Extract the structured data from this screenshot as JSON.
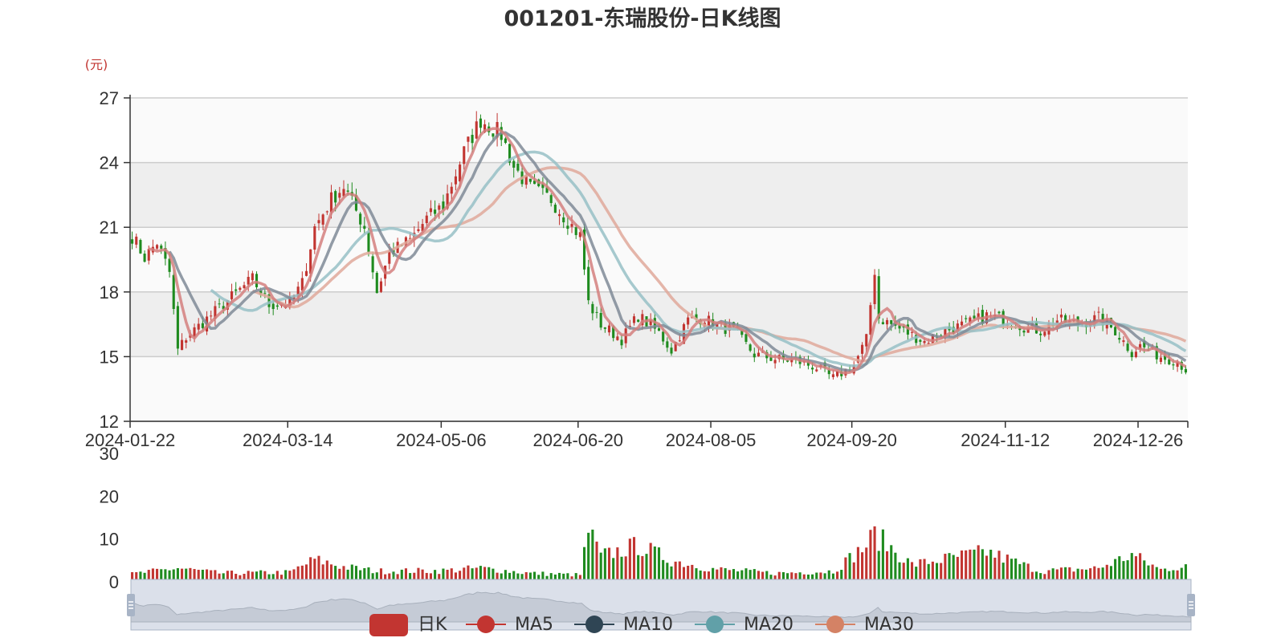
{
  "title": "001201-东瑞股份-日K线图",
  "unit_label": "(元)",
  "colors": {
    "up": "#c23531",
    "down": "#1f8b1f",
    "ma5": "#d47f7e",
    "ma10": "#7f8a96",
    "ma20": "#96bfc6",
    "ma30": "#dfa89a",
    "legend_k": "#c23531",
    "legend_ma5": "#c23531",
    "legend_ma10": "#2f4554",
    "legend_ma20": "#61a0a8",
    "legend_ma30": "#d48265"
  },
  "legend": [
    "日K",
    "MA5",
    "MA10",
    "MA20",
    "MA30"
  ],
  "chart_data": [
    {
      "type": "candlestick",
      "title": "001201-东瑞股份-日K线图",
      "ylabel": "(元)",
      "x_ticks": [
        "2024-01-22",
        "2024-03-14",
        "2024-05-06",
        "2024-06-20",
        "2024-08-05",
        "2024-09-20",
        "2024-11-12",
        "2024-12-26"
      ],
      "y_ticks": [
        "12",
        "15",
        "18",
        "21",
        "24",
        "27"
      ],
      "ylim": [
        12,
        27
      ],
      "grid": true,
      "close_anchors": [
        [
          "2024-01-22",
          20.6
        ],
        [
          "2024-01-25",
          19.6
        ],
        [
          "2024-01-30",
          20.3
        ],
        [
          "2024-02-02",
          18.9
        ],
        [
          "2024-02-06",
          15.3
        ],
        [
          "2024-02-08",
          15.9
        ],
        [
          "2024-02-22",
          17.6
        ],
        [
          "2024-03-01",
          18.6
        ],
        [
          "2024-03-07",
          17.4
        ],
        [
          "2024-03-14",
          17.5
        ],
        [
          "2024-03-19",
          18.4
        ],
        [
          "2024-03-22",
          21.0
        ],
        [
          "2024-03-28",
          22.3
        ],
        [
          "2024-04-02",
          22.9
        ],
        [
          "2024-04-09",
          21.0
        ],
        [
          "2024-04-12",
          18.0
        ],
        [
          "2024-04-17",
          19.8
        ],
        [
          "2024-04-24",
          20.4
        ],
        [
          "2024-04-30",
          21.4
        ],
        [
          "2024-05-06",
          22.0
        ],
        [
          "2024-05-13",
          24.5
        ],
        [
          "2024-05-17",
          26.0
        ],
        [
          "2024-05-24",
          25.3
        ],
        [
          "2024-05-29",
          23.8
        ],
        [
          "2024-06-04",
          22.8
        ],
        [
          "2024-06-11",
          22.3
        ],
        [
          "2024-06-17",
          21.3
        ],
        [
          "2024-06-20",
          20.6
        ],
        [
          "2024-06-24",
          17.5
        ],
        [
          "2024-06-27",
          16.5
        ],
        [
          "2024-07-04",
          15.8
        ],
        [
          "2024-07-10",
          16.9
        ],
        [
          "2024-07-17",
          16.1
        ],
        [
          "2024-07-22",
          15.3
        ],
        [
          "2024-07-26",
          16.7
        ],
        [
          "2024-08-01",
          16.8
        ],
        [
          "2024-08-05",
          16.5
        ],
        [
          "2024-08-12",
          16.2
        ],
        [
          "2024-08-19",
          15.1
        ],
        [
          "2024-08-26",
          14.9
        ],
        [
          "2024-09-02",
          14.8
        ],
        [
          "2024-09-09",
          14.5
        ],
        [
          "2024-09-13",
          14.0
        ],
        [
          "2024-09-20",
          14.6
        ],
        [
          "2024-09-25",
          15.8
        ],
        [
          "2024-09-27",
          19.0
        ],
        [
          "2024-09-30",
          16.8
        ],
        [
          "2024-10-10",
          16.0
        ],
        [
          "2024-10-15",
          15.7
        ],
        [
          "2024-10-22",
          16.2
        ],
        [
          "2024-10-29",
          16.5
        ],
        [
          "2024-11-05",
          16.9
        ],
        [
          "2024-11-12",
          16.7
        ],
        [
          "2024-11-18",
          16.4
        ],
        [
          "2024-11-22",
          16.2
        ],
        [
          "2024-11-28",
          16.7
        ],
        [
          "2024-12-05",
          16.5
        ],
        [
          "2024-12-12",
          16.8
        ],
        [
          "2024-12-18",
          16.2
        ],
        [
          "2024-12-24",
          15.2
        ],
        [
          "2024-12-26",
          15.5
        ],
        [
          "2025-01-02",
          15.0
        ],
        [
          "2025-01-08",
          14.8
        ],
        [
          "2025-01-10",
          14.4
        ]
      ],
      "series": [
        {
          "name": "日K",
          "kind": "candlestick"
        },
        {
          "name": "MA5",
          "kind": "line",
          "window": 5
        },
        {
          "name": "MA10",
          "kind": "line",
          "window": 10
        },
        {
          "name": "MA20",
          "kind": "line",
          "window": 20
        },
        {
          "name": "MA30",
          "kind": "line",
          "window": 30
        }
      ]
    },
    {
      "type": "bar",
      "y_ticks": [
        "0",
        "10",
        "20",
        "30"
      ],
      "ylim": [
        0,
        30
      ],
      "volume_anchors": [
        [
          "2024-01-22",
          1.8
        ],
        [
          "2024-02-06",
          3.2
        ],
        [
          "2024-02-20",
          2.0
        ],
        [
          "2024-03-14",
          2.2
        ],
        [
          "2024-03-22",
          5.2
        ],
        [
          "2024-04-02",
          3.5
        ],
        [
          "2024-04-12",
          2.5
        ],
        [
          "2024-05-06",
          2.6
        ],
        [
          "2024-05-17",
          3.2
        ],
        [
          "2024-06-04",
          2.0
        ],
        [
          "2024-06-20",
          1.6
        ],
        [
          "2024-06-24",
          12.0
        ],
        [
          "2024-06-27",
          6.0
        ],
        [
          "2024-07-10",
          8.5
        ],
        [
          "2024-07-22",
          5.0
        ],
        [
          "2024-08-05",
          3.0
        ],
        [
          "2024-08-26",
          2.0
        ],
        [
          "2024-09-13",
          2.5
        ],
        [
          "2024-09-25",
          8.5
        ],
        [
          "2024-09-27",
          11.0
        ],
        [
          "2024-10-10",
          4.0
        ],
        [
          "2024-11-05",
          7.0
        ],
        [
          "2024-11-22",
          2.5
        ],
        [
          "2024-12-12",
          3.2
        ],
        [
          "2024-12-24",
          6.3
        ],
        [
          "2025-01-02",
          2.8
        ],
        [
          "2025-01-10",
          3.8
        ]
      ]
    }
  ]
}
